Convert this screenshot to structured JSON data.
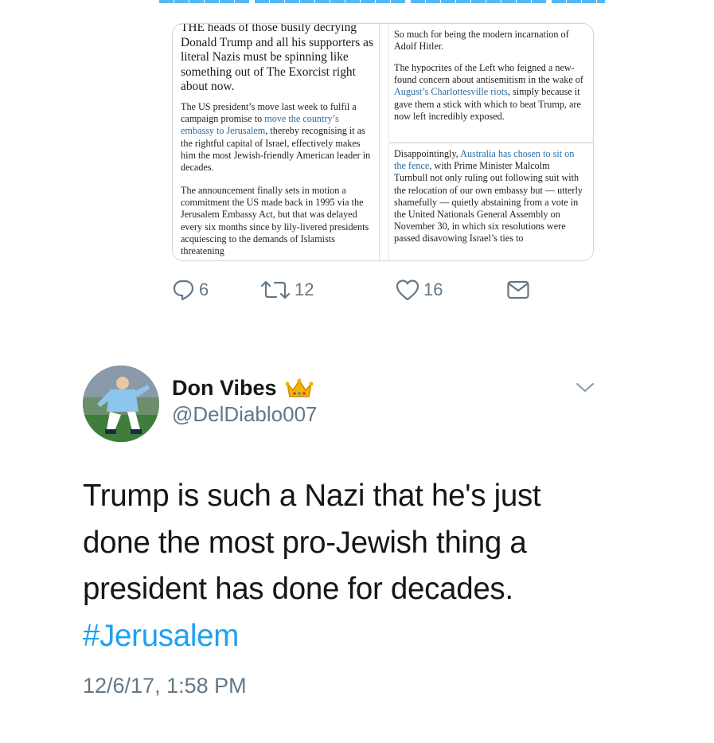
{
  "card": {
    "left_col": {
      "lead": "THE heads of those busily decrying Donald Trump and all his supporters as literal Nazis must be spinning like something out of The Exorcist right about now.",
      "p2_before": "The US president’s move last week to fulfil a campaign promise to ",
      "p2_link": "move the country’s embassy to Jerusalem",
      "p2_after": ", thereby recognising it as the rightful capital of Israel, effectively makes him the most Jewish-friendly American leader in decades.",
      "p3": "The announcement finally sets in motion a commitment the US made back in 1995 via the Jerusalem Embassy Act, but that was delayed every six months since by lily-livered presidents acquiescing to the demands of Islamists threatening"
    },
    "right_col": {
      "p1": "So much for being the modern incarnation of Adolf Hitler.",
      "p2_before": "The hypocrites of the Left who feigned a new-found concern about antisemitism in the wake of ",
      "p2_link": "August’s Charlottesville riots",
      "p2_after": ", simply because it gave them a stick with which to beat Trump, are now left incredibly exposed.",
      "p3_before": "Disappointingly, ",
      "p3_link": "Australia has chosen to sit on the fence",
      "p3_after": ", with Prime Minister Malcolm Turnbull not only ruling out following suit with the relocation of our own embassy but — utterly shamefully — quietly abstaining from a vote in the United Nationals General Assembly on November 30, in which six resolutions were passed disavowing Israel’s ties to"
    }
  },
  "actions": {
    "reply_count": "6",
    "retweet_count": "12",
    "like_count": "16"
  },
  "tweet": {
    "display_name": "Don Vibes",
    "handle": "@DelDiablo007",
    "text": "Trump is such a Nazi that he's just done the most pro-Jewish thing a president has done for decades.",
    "hashtag": "#Jerusalem",
    "timestamp": "12/6/17, 1:58 PM"
  },
  "colors": {
    "link": "#1da1f2",
    "muted": "#657786",
    "text": "#14171a"
  },
  "icons": [
    "reply-icon",
    "retweet-icon",
    "like-icon",
    "dm-icon",
    "crown-icon",
    "chevron-down-icon"
  ]
}
